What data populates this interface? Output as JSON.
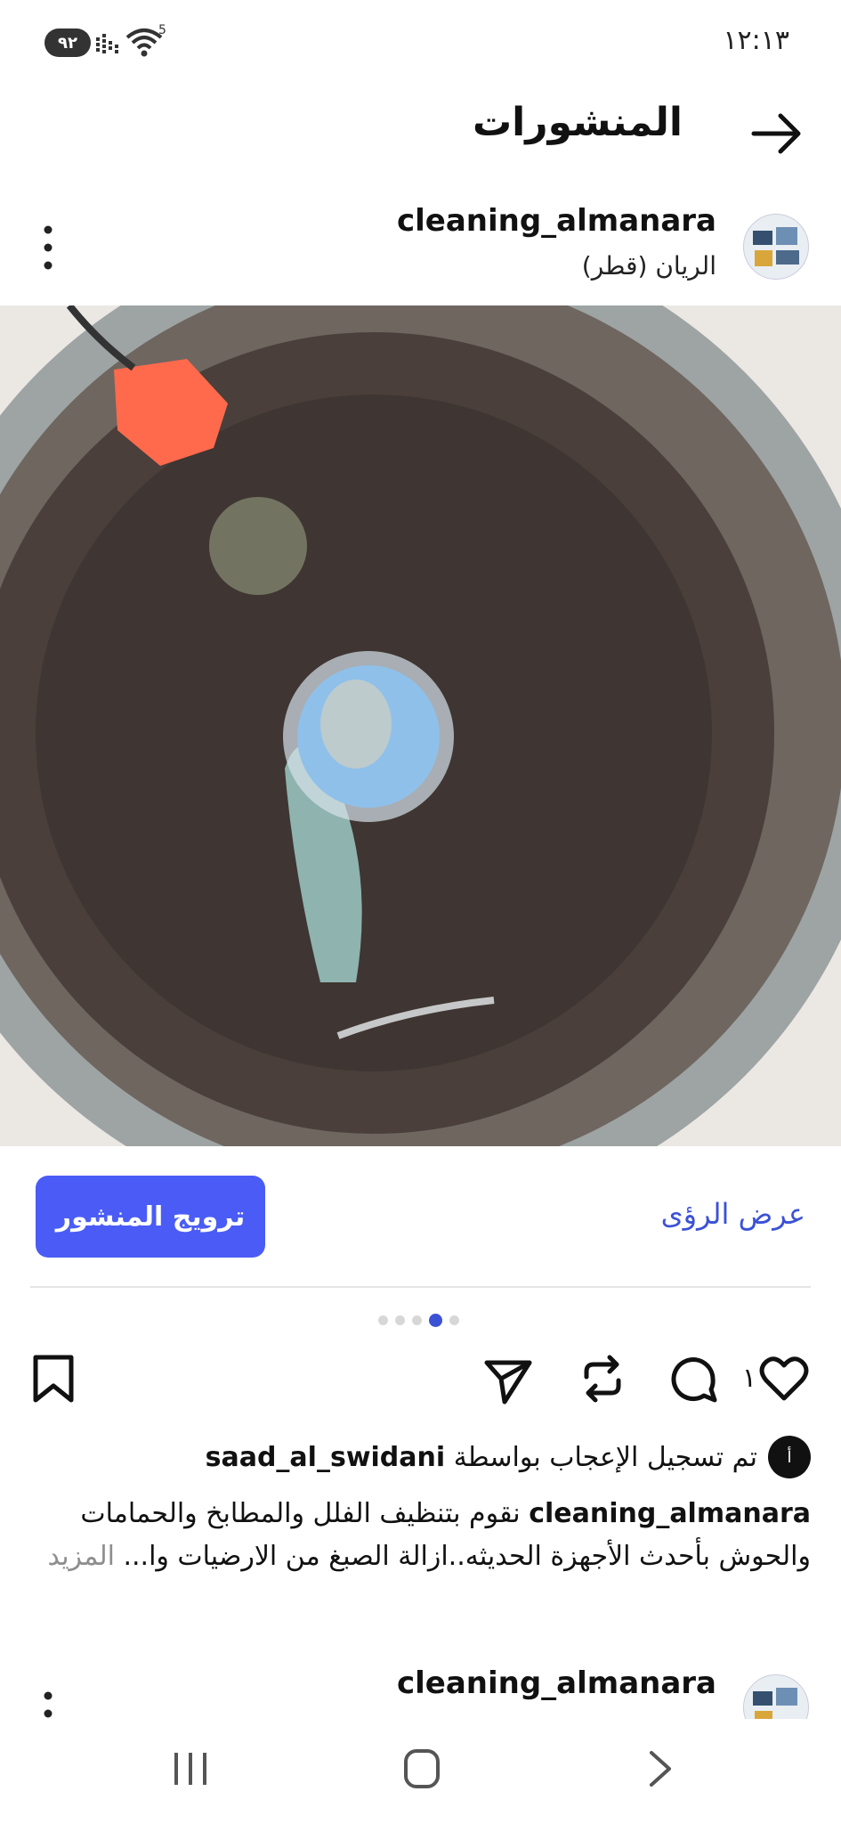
{
  "status_bar": {
    "time": "١٢:١٣",
    "battery": "٩٢",
    "wifi_badge": "5"
  },
  "header": {
    "title": "المنشورات"
  },
  "post": {
    "username": "cleaning_almanara",
    "location": "الريان (قطر)",
    "promote_label": "ترويج المنشور",
    "insights_label": "عرض الرؤى",
    "carousel": {
      "count": 5,
      "active_index": 3
    },
    "like_count": "١",
    "liked_by_prefix": "تم تسجيل الإعجاب بواسطة",
    "liked_by_user": "saad_al_swidani",
    "liker_avatar_letter": "أ",
    "caption_user": "cleaning_almanara",
    "caption_text": " نقوم بتنظيف الفلل والمطابخ والحمامات والحوش بأحدث الأجهزة الحديثه..ازالة الصبغ من الارضيات وا... ",
    "more_label": "المزيد"
  },
  "next_post": {
    "username": "cleaning_almanara"
  },
  "icons": [
    "arrow-right-icon",
    "more-vertical-icon",
    "heart-icon",
    "comment-icon",
    "repost-icon",
    "send-icon",
    "bookmark-icon",
    "recents-icon",
    "home-icon",
    "back-icon"
  ],
  "colors": {
    "accent": "#4a5cf5",
    "link": "#3b52d6"
  }
}
